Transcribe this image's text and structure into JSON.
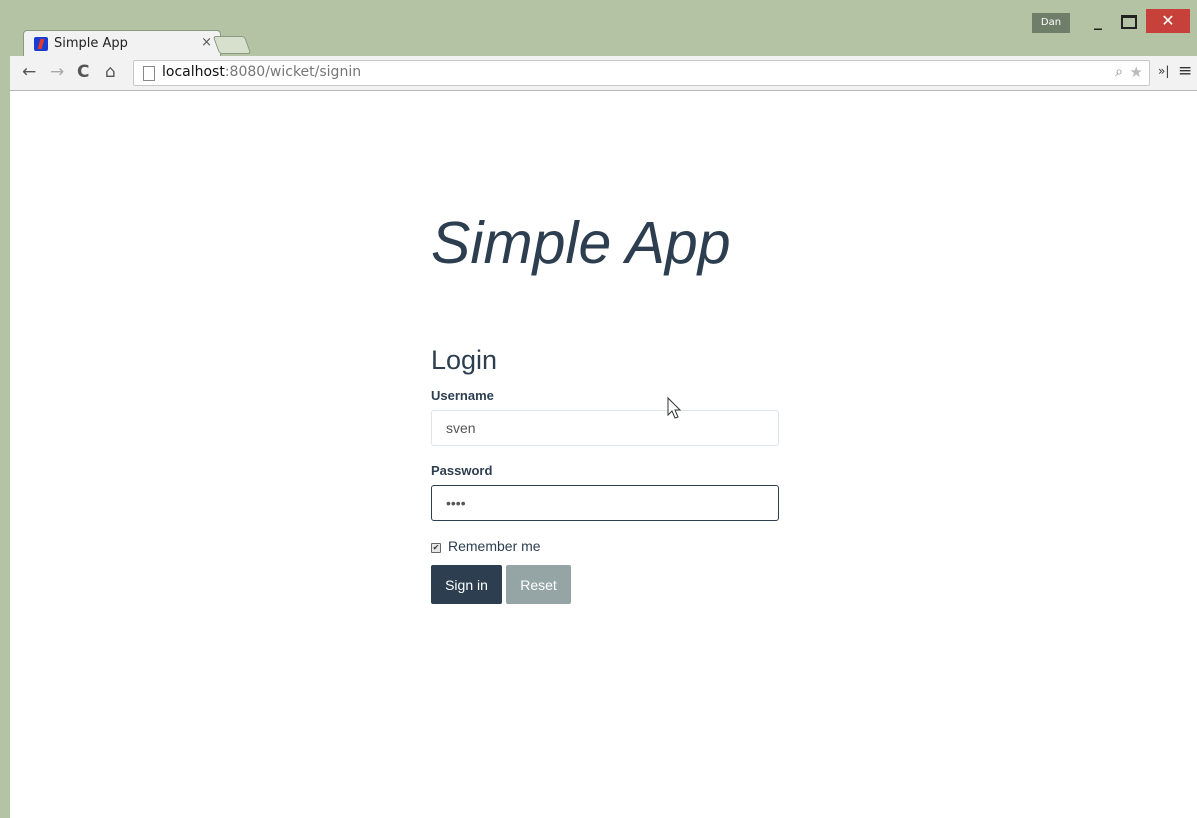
{
  "browser": {
    "tab_title": "Simple App",
    "tab_close": "×",
    "profile": "Dan",
    "url_host": "localhost",
    "url_rest": ":8080/wicket/signin",
    "window_buttons": {
      "minimize": "_",
      "close": "✕"
    }
  },
  "page": {
    "app_title": "Simple App",
    "form": {
      "heading": "Login",
      "username_label": "Username",
      "username_value": "sven",
      "password_label": "Password",
      "password_value": "••••",
      "remember_label": "Remember me",
      "remember_checked": true,
      "signin_label": "Sign in",
      "reset_label": "Reset"
    }
  },
  "colors": {
    "primary": "#2c3e50",
    "secondary": "#95a5a6",
    "frame": "#b3c3a3",
    "close_button": "#c7403a"
  }
}
